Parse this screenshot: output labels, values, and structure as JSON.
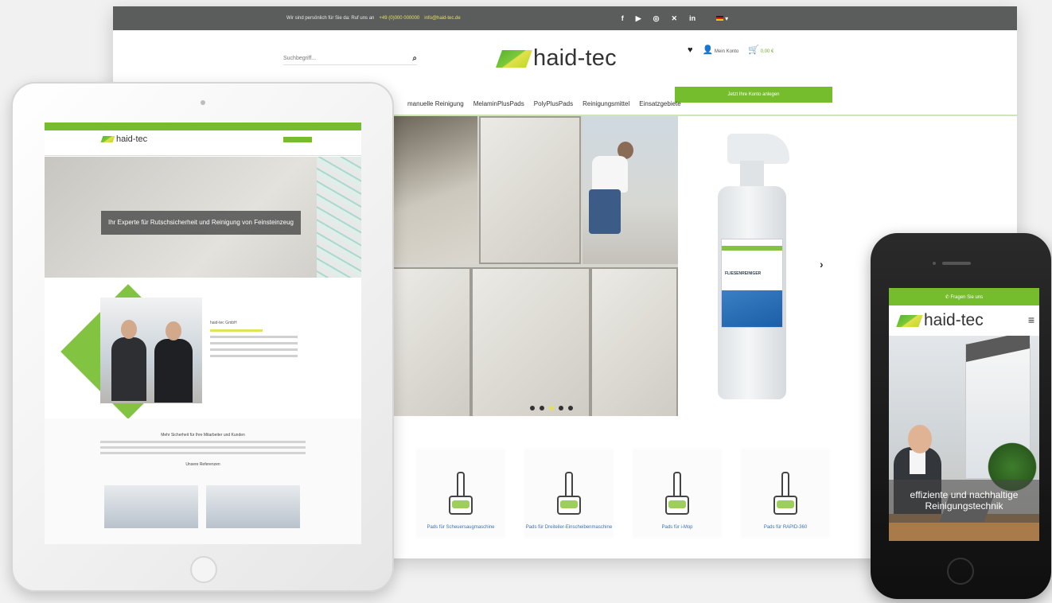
{
  "desktop": {
    "topbar": {
      "contact_text": "Wir sind persönlich für Sie da: Ruf uns an",
      "phone": "+49 (0)000 000000",
      "email": "info@haid-tec.de",
      "social_icons": [
        "facebook-icon",
        "youtube-icon",
        "instagram-icon",
        "xing-icon",
        "linkedin-icon"
      ],
      "social_glyphs": [
        "f",
        "▶",
        "◎",
        "✕",
        "in"
      ],
      "language_arrow": "▾"
    },
    "search": {
      "placeholder": "Suchbegriff..."
    },
    "logo_text": "haid-tec",
    "header_icons": {
      "wishlist_glyph": "♥",
      "account_label": "Mein Konto",
      "account_glyph": "👤",
      "cart_glyph": "🛒",
      "cart_total": "0,00 €"
    },
    "cta_label": "Jetzt Ihre Konto anlegen",
    "nav": [
      "manuelle Reinigung",
      "MelaminPlusPads",
      "PolyPlusPads",
      "Reinigungsmittel",
      "Einsatzgebiete"
    ],
    "slider_next": "›",
    "slider_dots": 5,
    "bottle_label": "FLIESENREINIGER",
    "categories": [
      {
        "label": "Pads für Scheuersaugmaschine"
      },
      {
        "label": "Pads für Dreiteiler-Einscheibenmaschine"
      },
      {
        "label": "Pads für i-Mop"
      },
      {
        "label": "Pads für RAPID-360"
      }
    ]
  },
  "tablet": {
    "logo_text": "haid-tec",
    "hero_banner": "Ihr Experte für Rutschsicherheit und Reinigung von Feinsteinzeug",
    "about_heading": "haid-tec GmbH",
    "more_heading": "Mehr Sicherheit für Ihre Mitarbeiter und Kunden",
    "references_heading": "Unsere Referenzen"
  },
  "phone": {
    "topbar": "✆ Fragen Sie uns",
    "logo_text": "haid-tec",
    "menu_glyph": "≡",
    "hero_caption": "effiziente und nachhaltige Reinigungstechnik"
  },
  "colors": {
    "brand_green": "#76bd2d",
    "topbar_gray": "#5b5c5c",
    "accent_yellow": "#e3e05a",
    "link_blue": "#3a72b5"
  }
}
